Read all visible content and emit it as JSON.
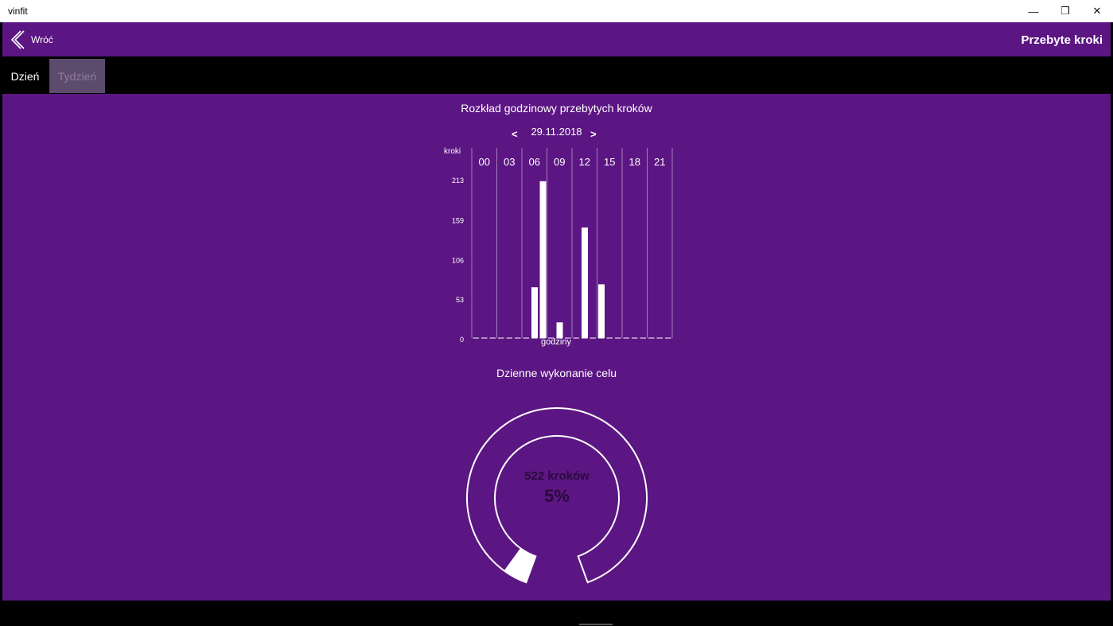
{
  "window": {
    "title": "vinfit",
    "minimize_glyph": "—",
    "restore_glyph": "❐",
    "close_glyph": "✕"
  },
  "header": {
    "back_label": "Wróć",
    "page_title": "Przebyte kroki"
  },
  "tabs": [
    {
      "label": "Dzień",
      "active": true
    },
    {
      "label": "Tydzień",
      "active": false
    }
  ],
  "chart_data": {
    "type": "bar",
    "title": "Rozkład godzinowy przebytych kroków",
    "xlabel": "godziny",
    "ylabel": "kroki",
    "yticks": [
      "213",
      "159",
      "106",
      "53",
      "0"
    ],
    "ylim": [
      0,
      213
    ],
    "column_labels": [
      "00",
      "03",
      "06",
      "09",
      "12",
      "15",
      "18",
      "21"
    ],
    "hours": [
      "0",
      "1",
      "2",
      "3",
      "4",
      "5",
      "6",
      "7",
      "8",
      "9",
      "10",
      "11",
      "12",
      "13",
      "14",
      "15",
      "16",
      "17",
      "18",
      "19",
      "20",
      "21",
      "22",
      "23"
    ],
    "values": [
      0,
      0,
      0,
      0,
      0,
      0,
      0,
      68,
      210,
      0,
      21,
      0,
      0,
      148,
      0,
      72,
      0,
      0,
      0,
      0,
      0,
      0,
      0,
      0,
      0
    ],
    "grid": true
  },
  "date_nav": {
    "prev": "<",
    "date": "29.11.2018",
    "next": ">"
  },
  "goal": {
    "title": "Dzienne wykonanie celu",
    "steps_text": "522 kroków",
    "percent_text": "5%",
    "fraction": 0.05
  },
  "colors": {
    "background": "#5c1683",
    "bar": "#ffffff",
    "text_dark": "#2a0a3a"
  }
}
